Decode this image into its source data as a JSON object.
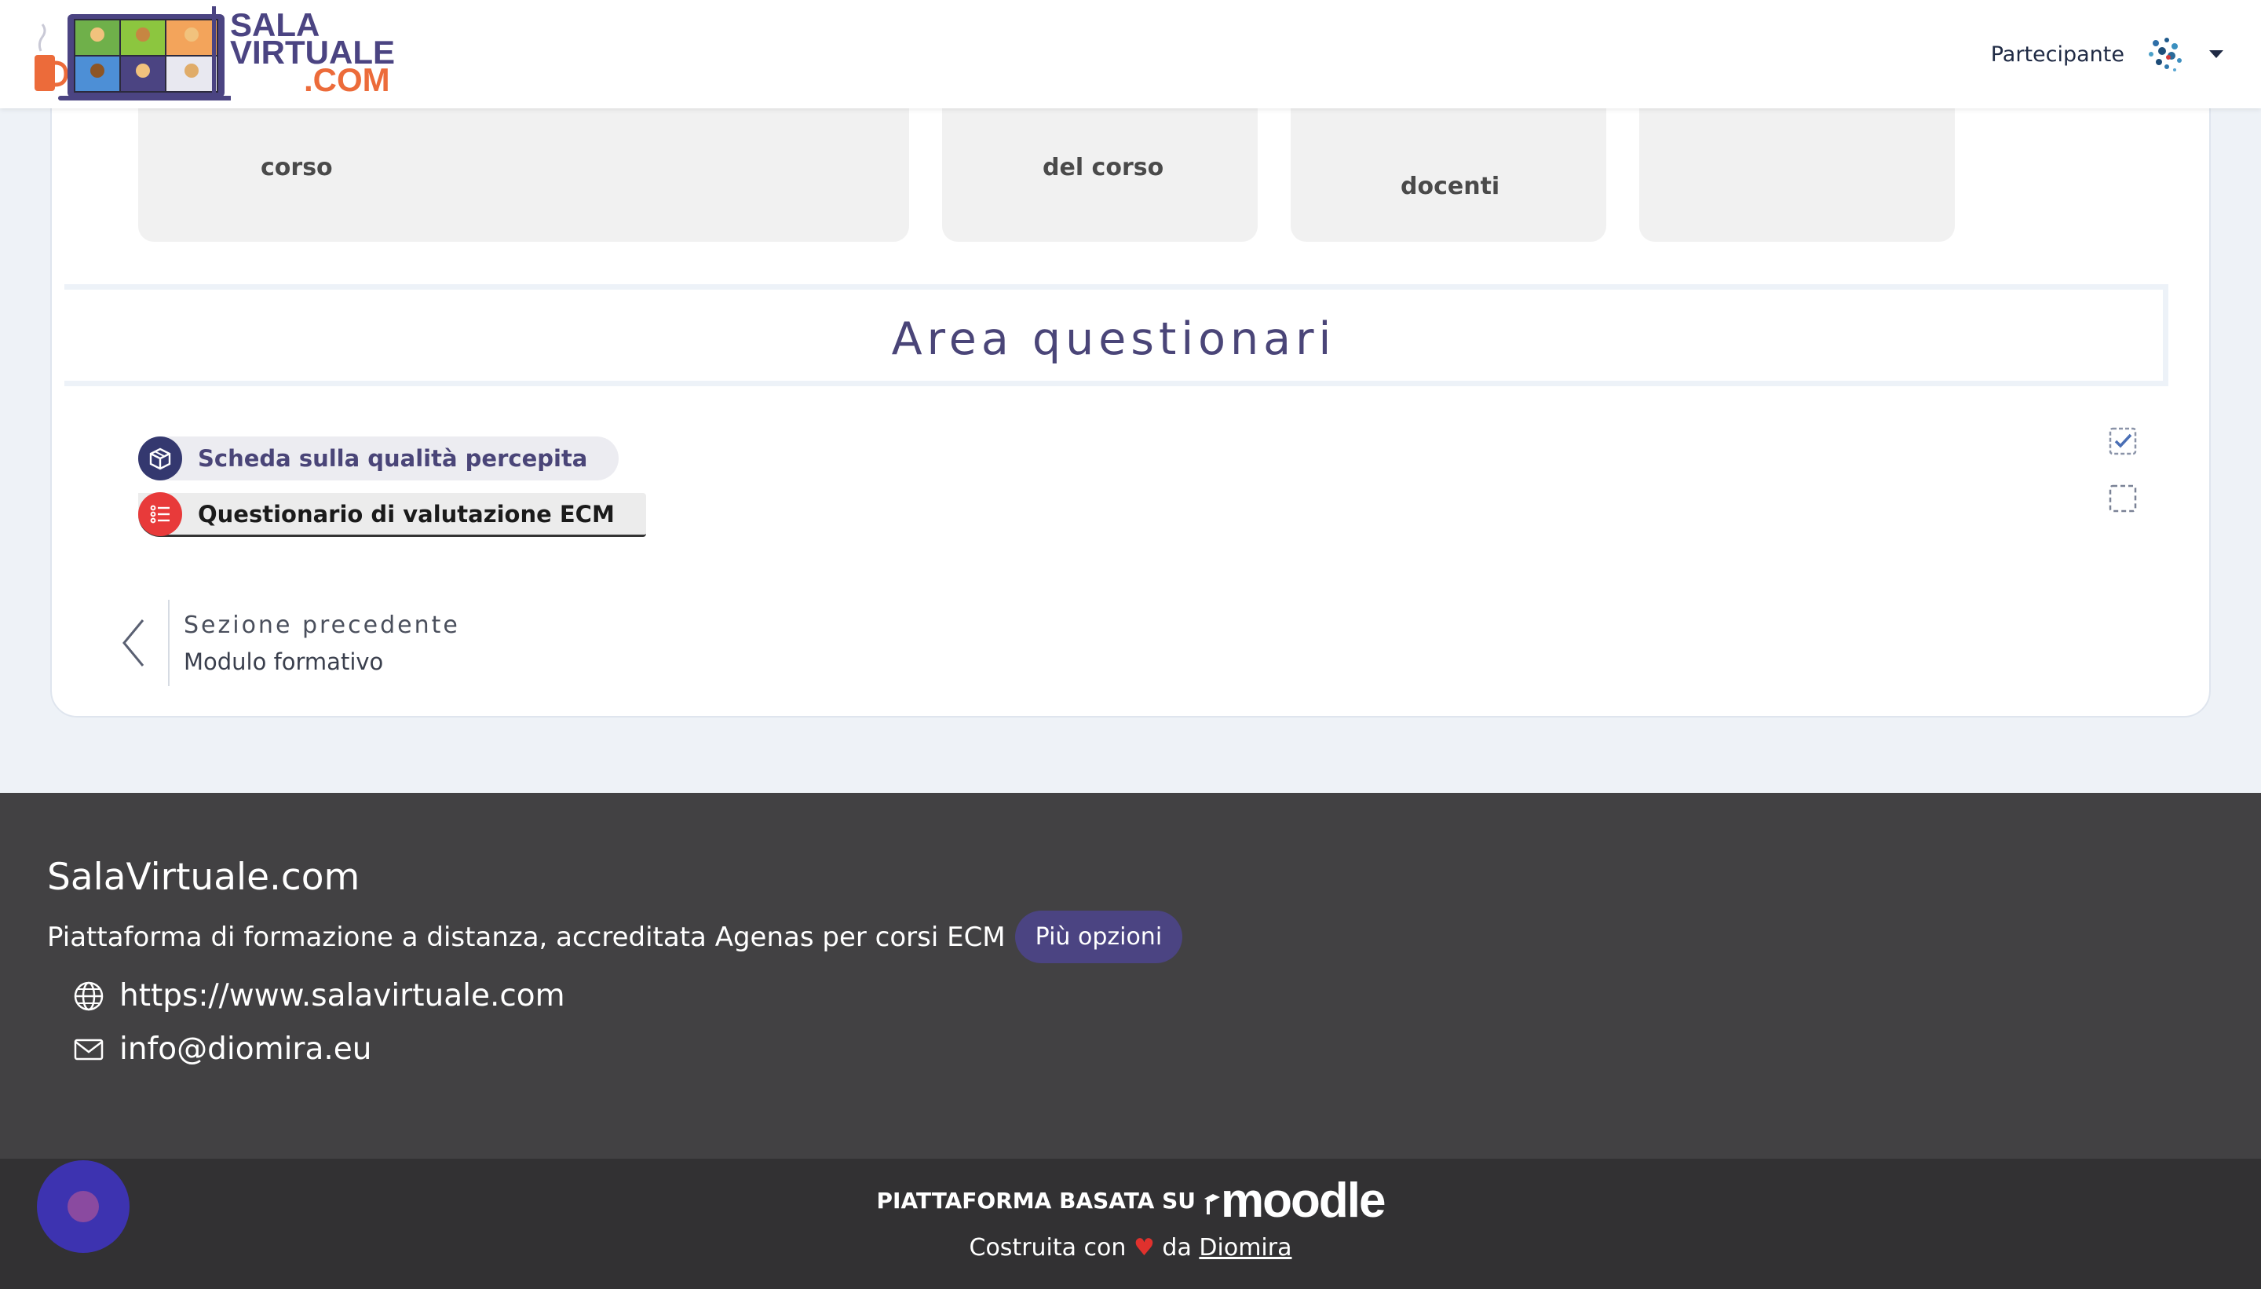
{
  "header": {
    "logo_line1": "SALA",
    "logo_line2": "VIRTUALE",
    "logo_line3": ".COM",
    "user_role": "Partecipante"
  },
  "course_tiles": [
    {
      "label": "corso"
    },
    {
      "label": "del corso"
    },
    {
      "label": "docenti"
    },
    {
      "label": ""
    }
  ],
  "section": {
    "title": "Area questionari",
    "activities": [
      {
        "name": "Scheda sulla qualità percepita",
        "icon": "feedback-box-icon",
        "completed": true
      },
      {
        "name": "Questionario di valutazione ECM",
        "icon": "questionnaire-list-icon",
        "completed": false
      }
    ],
    "prev_label": "Sezione precedente",
    "prev_name": "Modulo formativo"
  },
  "footer": {
    "site_name": "SalaVirtuale.com",
    "description": "Piattaforma di formazione a distanza, accreditata Agenas per corsi ECM",
    "more_button": "Più opzioni",
    "website": "https://www.salavirtuale.com",
    "email": "info@diomira.eu",
    "powered_by": "PIATTAFORMA BASATA SU",
    "moodle_logo": "moodle",
    "built_with": "Costruita con",
    "built_by_prefix": "da",
    "built_by": "Diomira"
  },
  "colors": {
    "brand_purple": "#4b4482",
    "brand_orange": "#ec6b3a",
    "footer_bg": "#424143",
    "footer_bottom_bg": "#323133",
    "heart_red": "#e0312d"
  }
}
